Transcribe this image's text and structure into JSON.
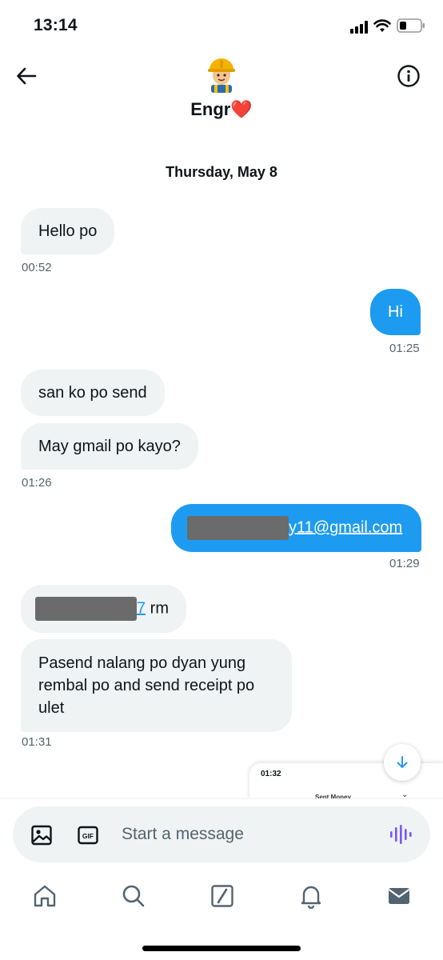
{
  "status_bar": {
    "time": "13:14"
  },
  "header": {
    "contact_name": "Engr",
    "heart": "❤️"
  },
  "conversation": {
    "date_divider": "Thursday, May 8",
    "messages": [
      {
        "dir": "in",
        "text": "Hello po",
        "time": "00:52"
      },
      {
        "dir": "out",
        "text": "Hi",
        "time": "01:25"
      },
      {
        "dir": "in",
        "text": "san ko po send"
      },
      {
        "dir": "in",
        "text": "May gmail po kayo?",
        "time": "01:26"
      },
      {
        "dir": "out",
        "text_suffix": "y11@gmail.com",
        "redacted": true,
        "time": "01:29"
      },
      {
        "dir": "in",
        "link_suffix": "7",
        "text_suffix": " rm",
        "redacted": true
      },
      {
        "dir": "in",
        "text": "Pasend nalang po dyan yung rembal po and send receipt po ulet",
        "time": "01:31"
      }
    ]
  },
  "preview_card": {
    "time": "01:32",
    "title": "Sent Money"
  },
  "composer": {
    "placeholder": "Start a message",
    "value": ""
  },
  "icons": {
    "back": "arrow-left-icon",
    "info": "info-icon",
    "image": "image-icon",
    "gif": "gif-icon",
    "voice": "voice-wave-icon",
    "scroll": "arrow-down-icon",
    "tabs": [
      "home-icon",
      "search-icon",
      "grok-icon",
      "bell-icon",
      "mail-icon"
    ]
  },
  "colors": {
    "accent": "#1d9bf0",
    "incoming_bubble": "#eff3f4",
    "voice": "#7856ff",
    "heart": "#e0245e"
  }
}
